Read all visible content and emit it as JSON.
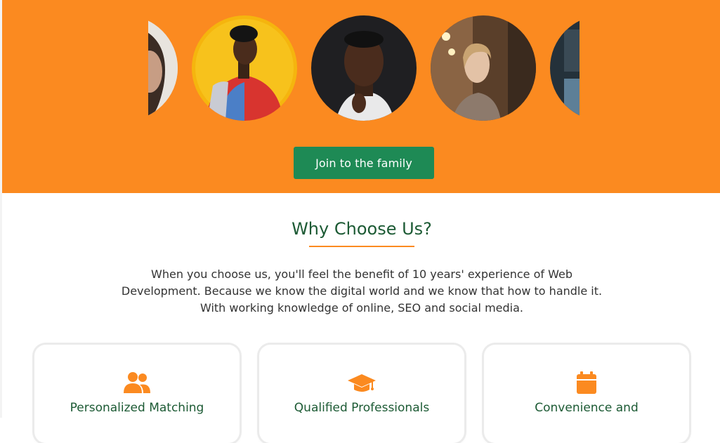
{
  "hero": {
    "cta_label": "Join to the family",
    "avatars": [
      "partial-portrait-left",
      "man-yellow-background",
      "man-dark-background",
      "woman-warm-background",
      "partial-portrait-right"
    ]
  },
  "why": {
    "title": "Why Choose Us?",
    "intro": "When you choose us, you'll feel the benefit of 10 years' experience of Web Development. Because we know the digital world and we know that how to handle it. With working knowledge of online, SEO and social media."
  },
  "cards": [
    {
      "title": "Personalized Matching",
      "icon": "users-icon"
    },
    {
      "title": "Qualified Professionals",
      "icon": "graduation-cap-icon"
    },
    {
      "title": "Convenience and",
      "icon": "calendar-icon"
    }
  ],
  "colors": {
    "hero_bg": "#fb8a20",
    "cta_bg": "#1e8a55",
    "heading": "#1c5a34",
    "accent": "#fb8a20"
  }
}
